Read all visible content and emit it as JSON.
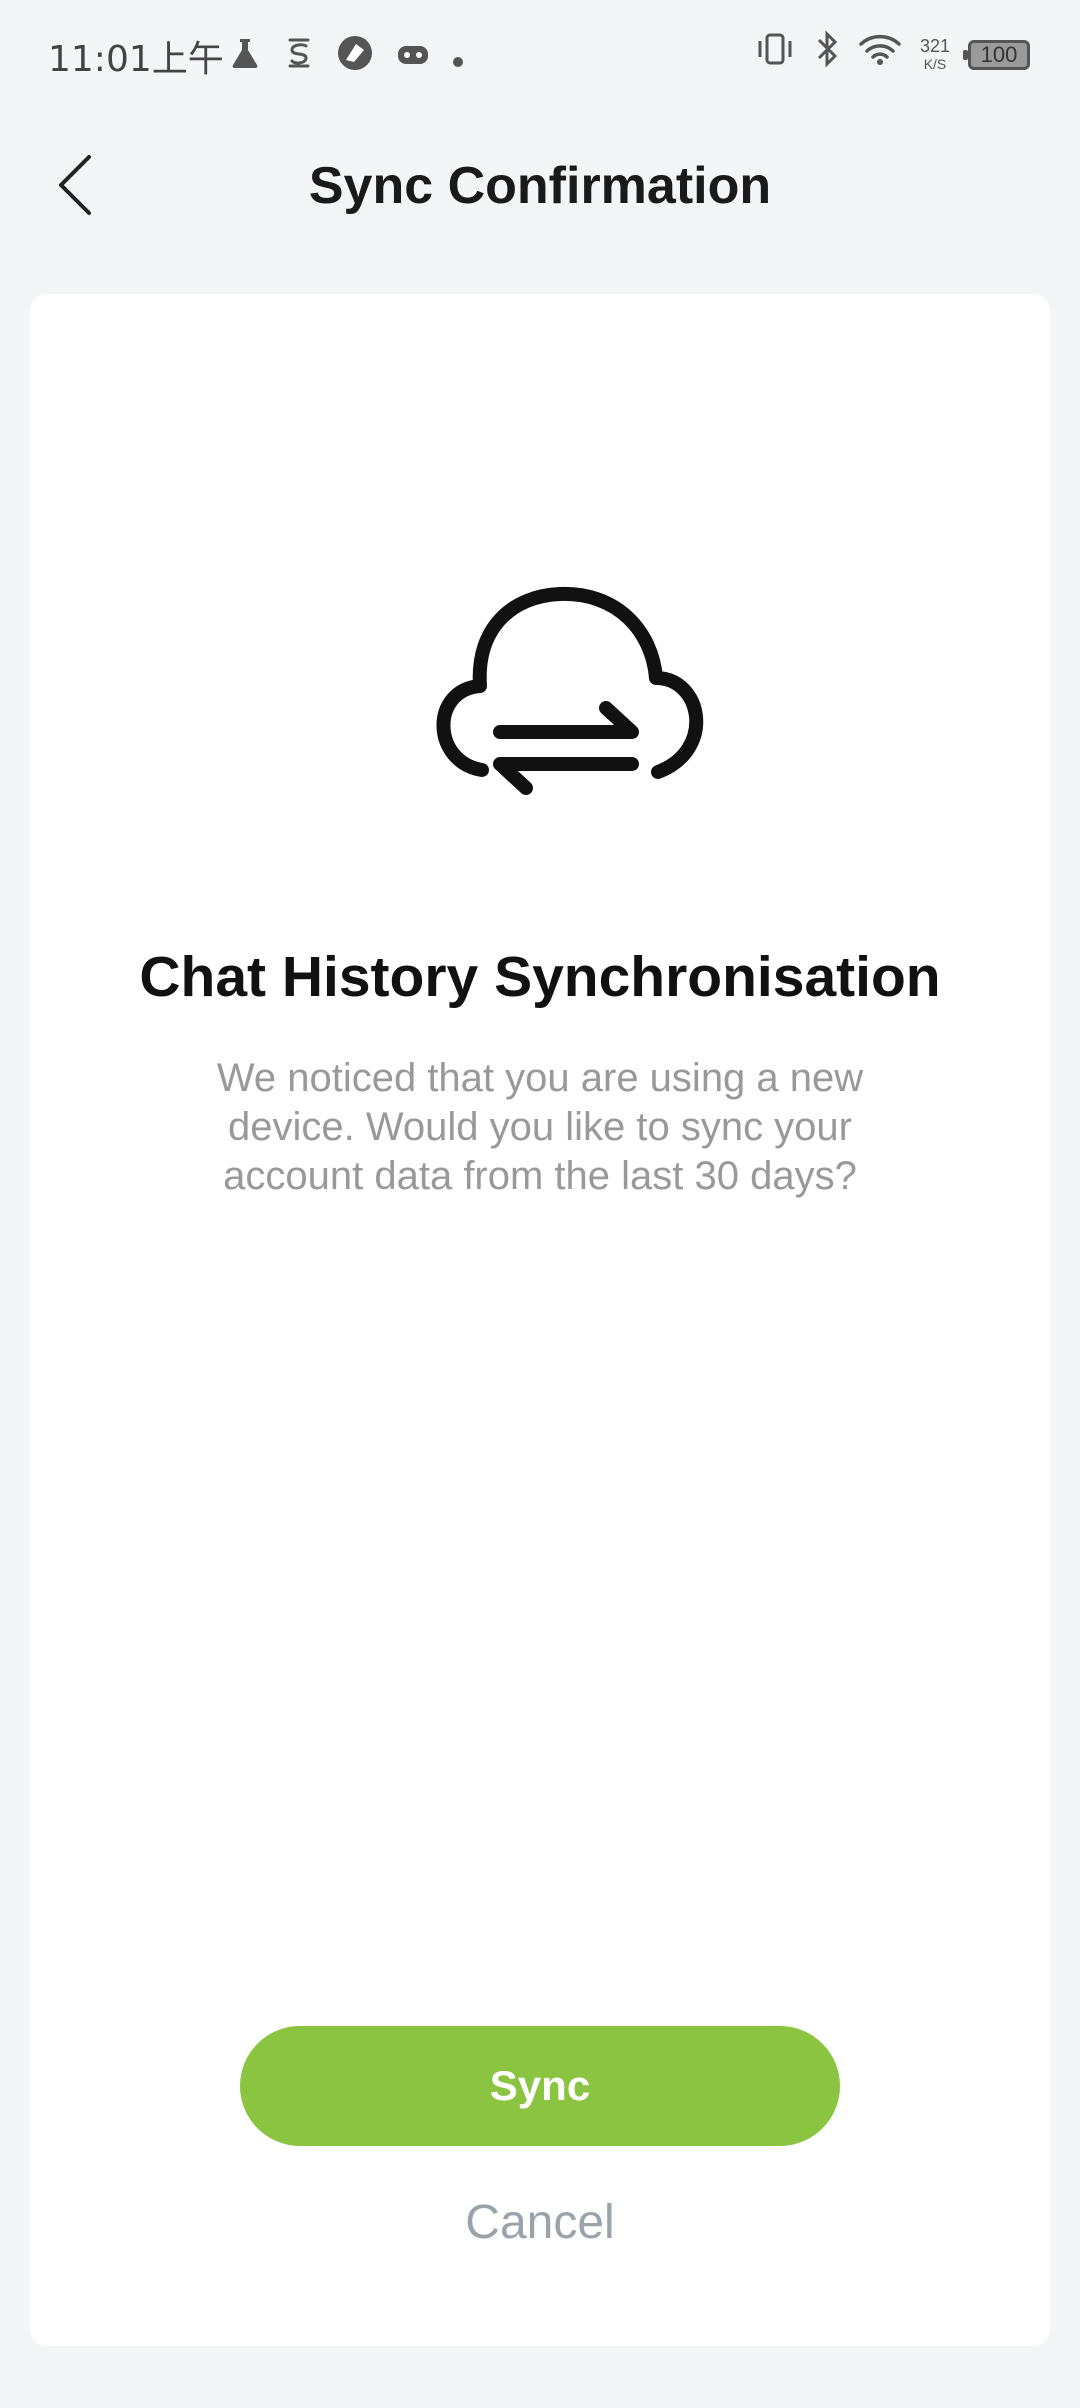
{
  "status_bar": {
    "time": "11:01上午",
    "net_speed_value": "321",
    "net_speed_unit": "K/S",
    "battery": "100",
    "left_icons": [
      "flask-icon",
      "s-icon",
      "browser-icon",
      "gamepad-icon",
      "dot-icon"
    ],
    "right_icons": [
      "vibrate-icon",
      "bluetooth-icon",
      "wifi-icon"
    ]
  },
  "header": {
    "title": "Sync Confirmation",
    "back_icon": "chevron-left-icon"
  },
  "content": {
    "icon": "cloud-sync-icon",
    "heading": "Chat History Synchronisation",
    "description": "We noticed that you are using a new device. Would you like to sync your account data from the last 30 days?"
  },
  "actions": {
    "sync_label": "Sync",
    "cancel_label": "Cancel"
  },
  "colors": {
    "accent": "#8bc441",
    "background": "#f4f5f7",
    "card": "#ffffff",
    "secondary_text": "#999999"
  }
}
